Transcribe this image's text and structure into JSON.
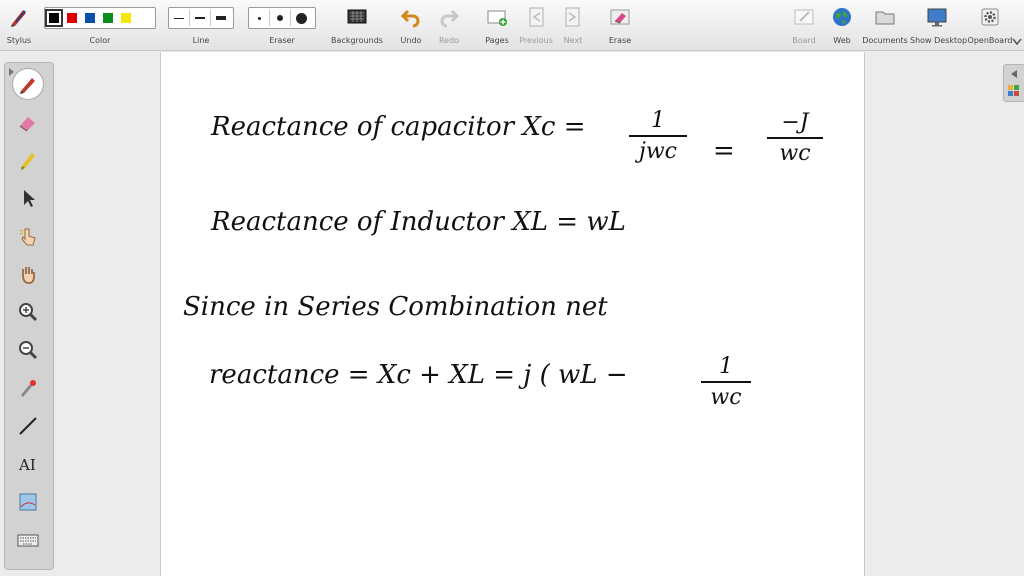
{
  "toolbar": {
    "stylus": "Stylus",
    "color": "Color",
    "line": "Line",
    "eraser": "Eraser",
    "backgrounds": "Backgrounds",
    "undo": "Undo",
    "redo": "Redo",
    "pages": "Pages",
    "previous": "Previous",
    "next": "Next",
    "erase": "Erase",
    "board": "Board",
    "web": "Web",
    "documents": "Documents",
    "show_desktop": "Show Desktop",
    "openboard": "OpenBoard",
    "colors": [
      "#000000",
      "#e00000",
      "#0a4fa8",
      "#0c8c1c",
      "#f3e600"
    ],
    "selected_color": "#000000"
  },
  "sidebar": {
    "items": [
      {
        "icon": "pen-icon"
      },
      {
        "icon": "eraser-icon"
      },
      {
        "icon": "marker-icon"
      },
      {
        "icon": "selector-icon"
      },
      {
        "icon": "interact-icon"
      },
      {
        "icon": "hand-icon"
      },
      {
        "icon": "zoom-in-icon"
      },
      {
        "icon": "zoom-out-icon"
      },
      {
        "icon": "laser-icon"
      },
      {
        "icon": "line-icon"
      },
      {
        "icon": "text-icon"
      },
      {
        "icon": "capture-icon"
      },
      {
        "icon": "keyboard-icon"
      }
    ]
  },
  "board": {
    "line1_text": "Reactance of capacitor  Xc  =",
    "line1_f1_num": "1",
    "line1_f1_den": "jwc",
    "line1_eq": "=",
    "line1_f2_num": "−J",
    "line1_f2_den": "wc",
    "line2_text": "Reactance of  Inductor    XL = wL",
    "line3_text": "Since  in  Series  Combination  net",
    "line4_text": "reactance  =  Xc + XL  =  j ( wL −",
    "line4_f_num": "1",
    "line4_f_den": "wc"
  }
}
